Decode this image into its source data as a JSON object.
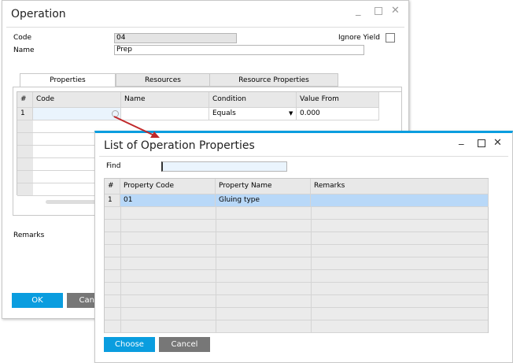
{
  "operation": {
    "title": "Operation",
    "code_label": "Code",
    "code_value": "04",
    "name_label": "Name",
    "name_value": "Prep",
    "ignore_yield_label": "Ignore Yield",
    "ignore_yield_checked": false,
    "tabs": [
      "Properties",
      "Resources",
      "Resource Properties"
    ],
    "active_tab": "Properties",
    "grid": {
      "columns": [
        "#",
        "Code",
        "Name",
        "Condition",
        "Value From"
      ],
      "rows": [
        {
          "num": "1",
          "code": "",
          "name": "",
          "condition": "Equals",
          "value_from": "0.000"
        }
      ]
    },
    "remarks_label": "Remarks",
    "ok_label": "OK",
    "cancel_label": "Cancel"
  },
  "list": {
    "title": "List of Operation Properties",
    "find_label": "Find",
    "find_value": "",
    "columns": [
      "#",
      "Property Code",
      "Property Name",
      "Remarks"
    ],
    "rows": [
      {
        "num": "1",
        "code": "01",
        "name": "Gluing type",
        "remarks": ""
      }
    ],
    "choose_label": "Choose",
    "cancel_label": "Cancel"
  },
  "colors": {
    "accent": "#0a9ddf",
    "selected_row": "#b8d8f8",
    "arrow": "#c0282a"
  }
}
